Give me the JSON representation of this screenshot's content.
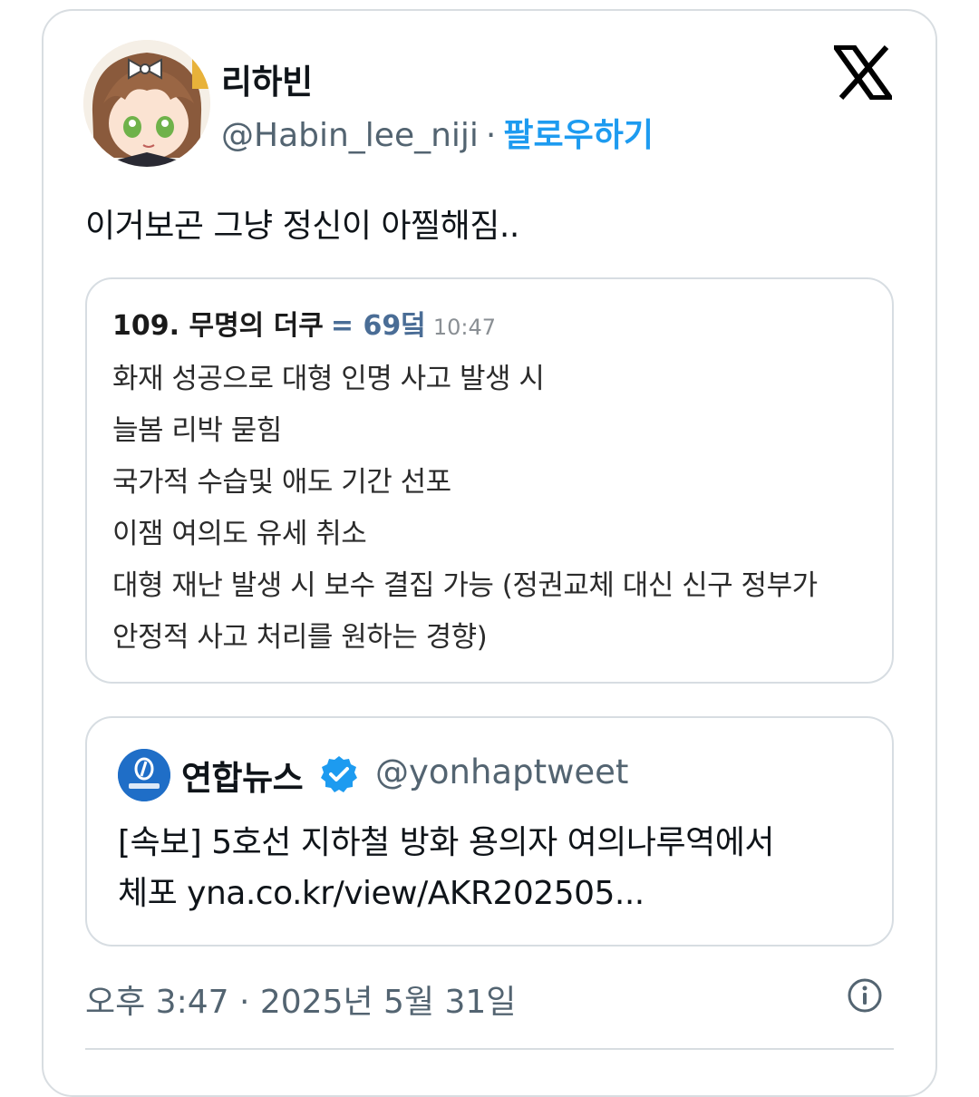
{
  "author": {
    "display_name": "리하빈",
    "handle": "@Habin_lee_niji",
    "separator": "·",
    "follow_label": "팔로우하기",
    "avatar_icon": "anime-character-avatar"
  },
  "platform_icon": "x-logo-icon",
  "tweet": {
    "text": "이거보곤 그냥 정신이 아찔해짐.."
  },
  "embedded_image": {
    "post_number": "109. 무명의 더쿠",
    "score": "= 69덬",
    "time": "10:47",
    "lines": [
      "화재 성공으로 대형 인명 사고 발생 시",
      "늘봄 리박 묻힘",
      "국가적 수습및 애도 기간 선포",
      "이잼 여의도 유세 취소",
      "대형 재난 발생 시 보수 결집 가능 (정권교체 대신 신구 정부가",
      "안정적 사고 처리를 원하는 경향)"
    ]
  },
  "quoted_tweet": {
    "account_name": "연합뉴스",
    "handle": "@yonhaptweet",
    "verified_icon": "verified-badge-icon",
    "text_line1": "[속보] 5호선 지하철 방화 용의자 여의나루역에서",
    "text_line2": "체포 yna.co.kr/view/AKR202505..."
  },
  "timestamp": "오후 3:47 · 2025년 5월 31일",
  "colors": {
    "follow": "#1d9bf0",
    "secondary_text": "#536471",
    "score": "#4a6d96",
    "border": "#d8dde1"
  }
}
